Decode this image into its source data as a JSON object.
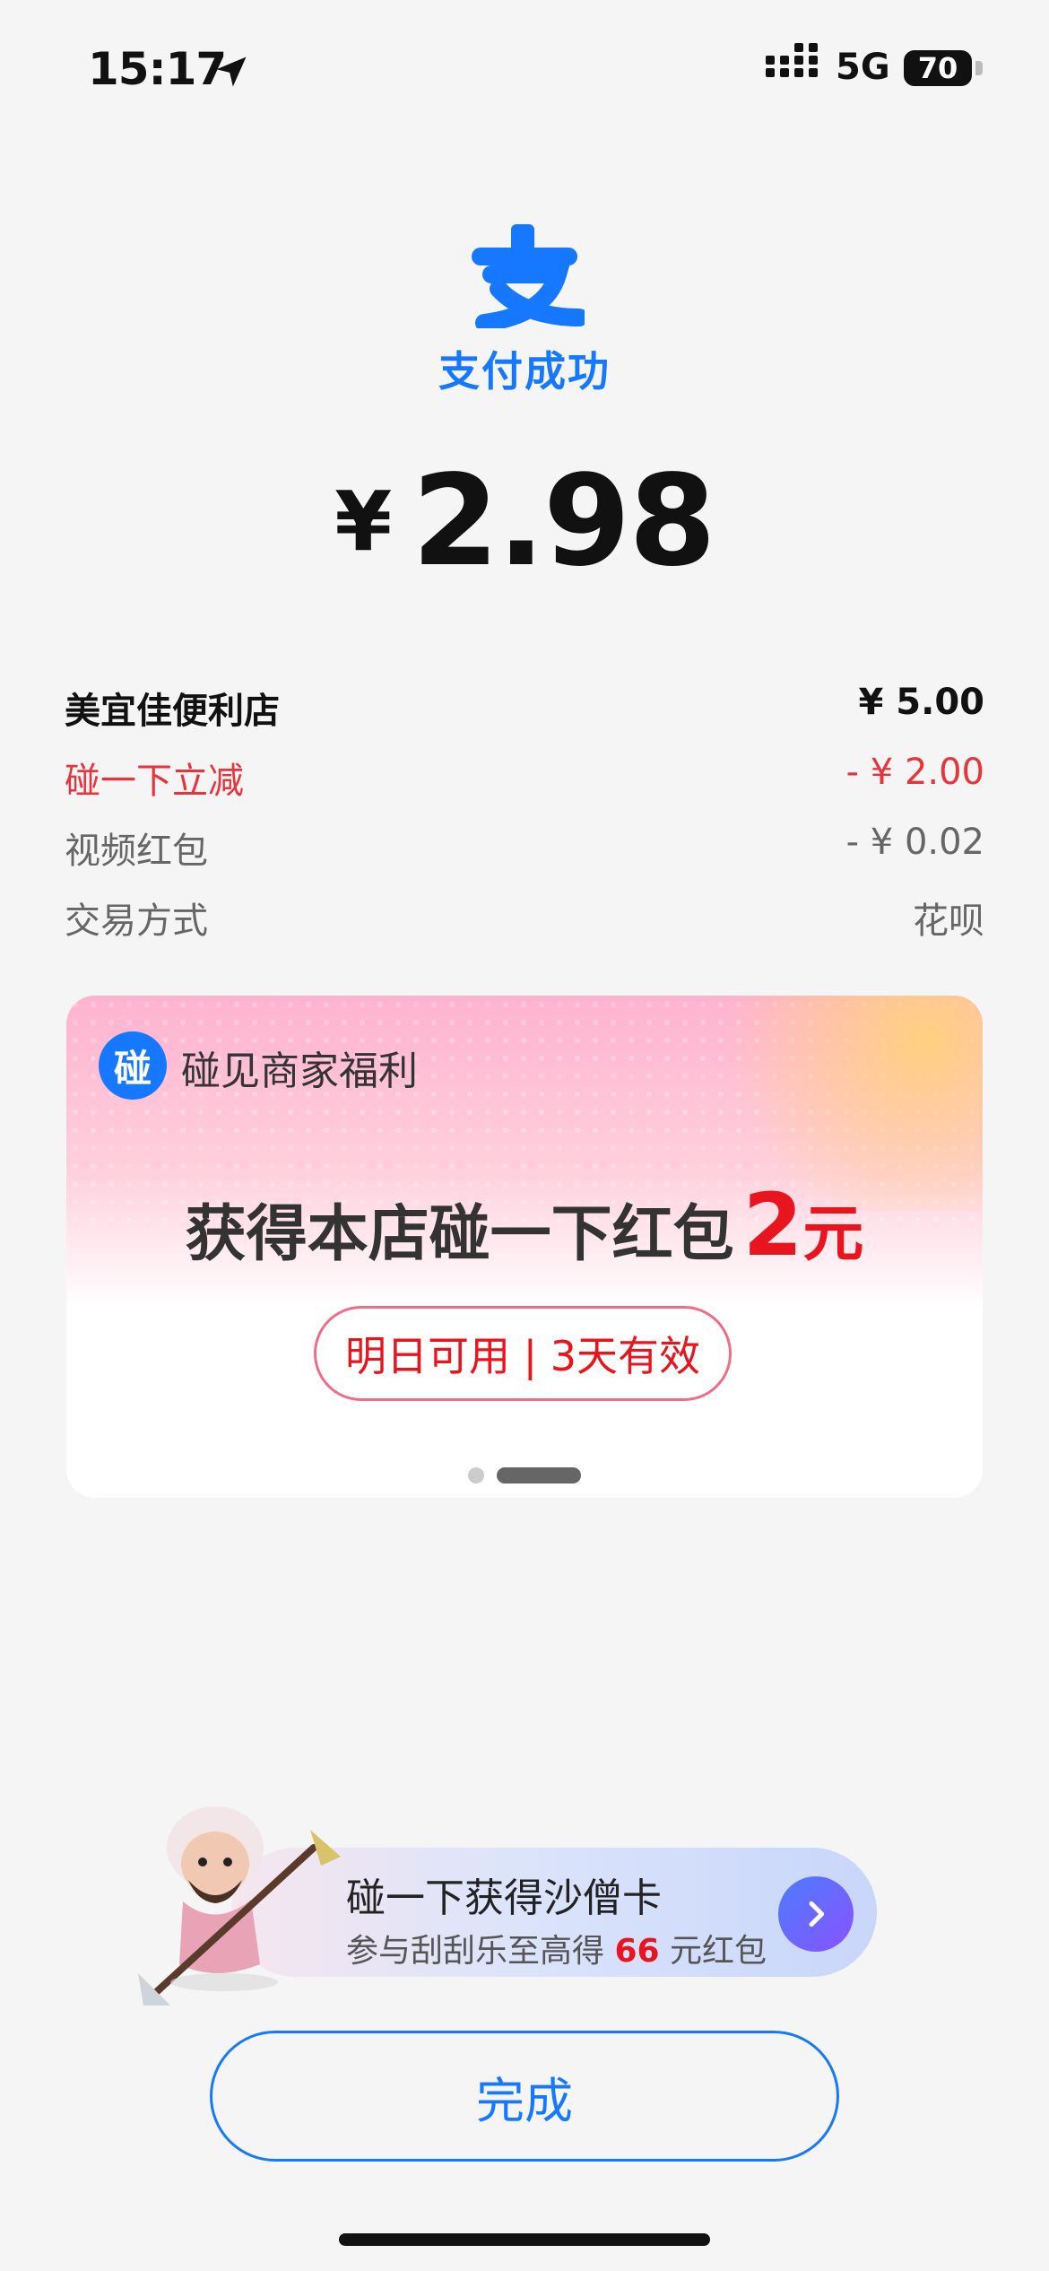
{
  "status_bar": {
    "time": "15:17",
    "network": "5G",
    "battery": "70"
  },
  "header": {
    "logo_glyph": "支",
    "success_text": "支付成功"
  },
  "payment": {
    "currency_symbol": "¥",
    "amount": "2.98"
  },
  "details": [
    {
      "label": "美宜佳便利店",
      "value": "¥ 5.00"
    },
    {
      "label": "碰一下立减",
      "value": "- ¥ 2.00"
    },
    {
      "label": "视频红包",
      "value": "- ¥ 0.02"
    },
    {
      "label": "交易方式",
      "value": "花呗"
    }
  ],
  "promo_card": {
    "badge_glyph": "碰",
    "title": "碰见商家福利",
    "headline_text": "获得本店碰一下红包",
    "headline_amount": "2",
    "headline_unit": "元",
    "pill_text": "明日可用 | 3天有效",
    "carousel_pages": 2,
    "carousel_active": 2
  },
  "promo_strip": {
    "title": "碰一下获得沙僧卡",
    "sub_prefix": "参与刮刮乐至高得",
    "sub_amount": "66",
    "sub_suffix": "元红包"
  },
  "done_button": {
    "label": "完成"
  },
  "colors": {
    "accent": "#1677ff",
    "discount_red": "#e8333a",
    "highlight_red": "#e8141e"
  }
}
